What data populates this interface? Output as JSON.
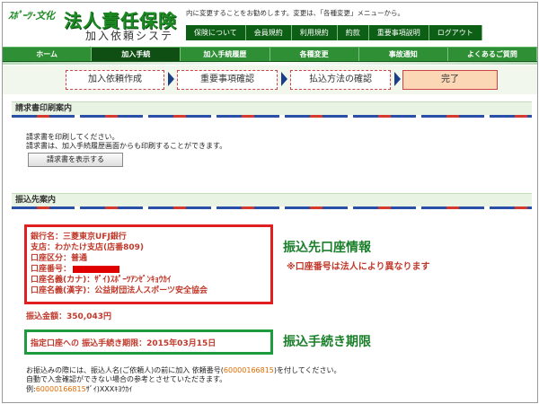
{
  "header": {
    "logo_brand": "ｽﾎﾟｰﾂ･文化",
    "logo_title": "法人責任保険",
    "logo_sub": "加入依頼システム",
    "notice": "内に変更することをお勧めします。変更は、「各種変更」メニューから。",
    "util_nav": [
      "保険について",
      "会員規約",
      "利用規約",
      "約款",
      "重要事項説明",
      "ログアウト"
    ]
  },
  "main_nav": {
    "items": [
      "ホーム",
      "加入手続",
      "加入手続履歴",
      "各種変更",
      "事故通知",
      "よくあるご質問"
    ],
    "active_index": 1
  },
  "steps": [
    "加入依頼作成",
    "重要事項確認",
    "払込方法の確認",
    "完了"
  ],
  "print_section": {
    "heading": "請求書印刷案内",
    "line1": "請求書を印刷してください。",
    "line2": "請求書は、加入手続履歴画面からも印刷することができます。",
    "button": "請求書を表示する"
  },
  "transfer_section": {
    "heading": "振込先案内",
    "bank_lines": {
      "bank": "銀行名：三菱東京UFJ銀行",
      "branch": "支店：わかたけ支店(店番809)",
      "type": "口座区分：普通",
      "number_label": "口座番号：",
      "kana": "口座名義(カナ)：ｻﾞｲ)ｽﾎﾟｰﾂｱﾝｾﾞﾝｷｮｳｶｲ",
      "kanji": "口座名義(漢字)：公益財団法人スポーツ安全協会"
    },
    "callout_title": "振込先口座情報",
    "callout_note": "※口座番号は法人により異なります",
    "amount": "振込金額：350,043円",
    "deadline": "指定口座への 振込手続き期限：2015年03月15日",
    "deadline_callout": "振込手続き期限",
    "foot_line1_pre": "お振込みの際には、振込人名(ご依頼人)の前に加入 依頼番号(",
    "foot_number": "60000166815",
    "foot_line1_post": ")を付してください。",
    "foot_line2": "自動で入金確認ができない場合の参考とさせていただきます。",
    "foot_example_pre": "例:",
    "foot_example_num": "60000166815",
    "foot_example_post": "ｻﾞｲ)XXXｷﾖｳｶｲ"
  },
  "colors": {
    "brand_green": "#1d8b24",
    "alert_red": "#e02020",
    "deadline_green": "#1f9b3f"
  }
}
